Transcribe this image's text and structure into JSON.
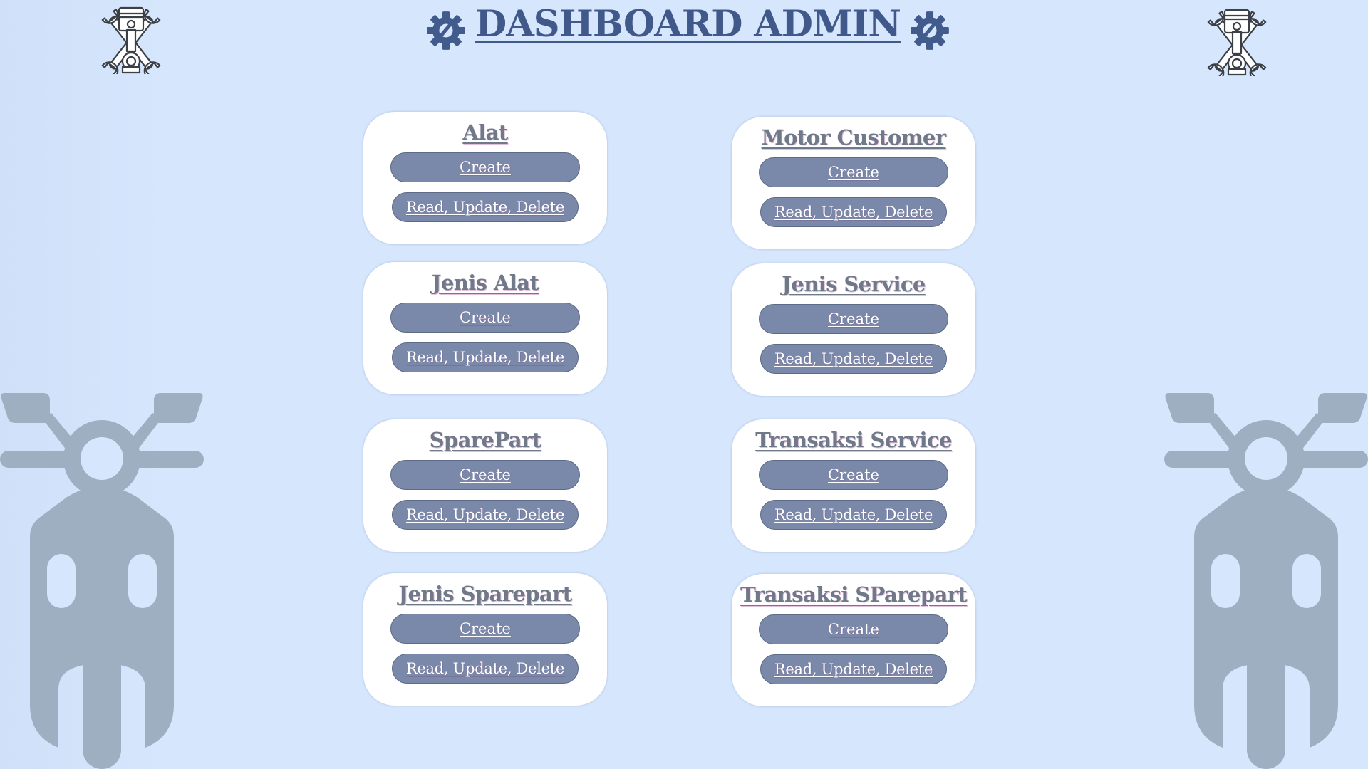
{
  "header": {
    "title": "DASHBOARD ADMIN"
  },
  "icons": {
    "left_gear": "gear-icon",
    "right_gear": "gear-icon",
    "left_logo": "wrench-piston-icon",
    "right_logo": "wrench-piston-icon",
    "left_scooter": "scooter-icon",
    "right_scooter": "scooter-icon"
  },
  "colors": {
    "background": "#d5e6fd",
    "title": "#40598a",
    "card": "#ffffff",
    "button": "#7a88a9",
    "card_title": "#6f7989",
    "scooter": "#9fafc2"
  },
  "cards": [
    {
      "title": "Alat",
      "create": "Create",
      "rud": "Read, Update, Delete"
    },
    {
      "title": "Motor Customer",
      "create": "Create",
      "rud": "Read, Update, Delete"
    },
    {
      "title": "Jenis Alat",
      "create": "Create",
      "rud": "Read, Update, Delete"
    },
    {
      "title": "Jenis Service",
      "create": "Create",
      "rud": "Read, Update, Delete"
    },
    {
      "title": "SparePart",
      "create": "Create",
      "rud": "Read, Update, Delete"
    },
    {
      "title": "Transaksi Service",
      "create": "Create",
      "rud": "Read, Update, Delete"
    },
    {
      "title": "Jenis Sparepart",
      "create": "Create",
      "rud": "Read, Update, Delete"
    },
    {
      "title": "Transaksi SParepart",
      "create": "Create",
      "rud": "Read, Update, Delete"
    }
  ]
}
